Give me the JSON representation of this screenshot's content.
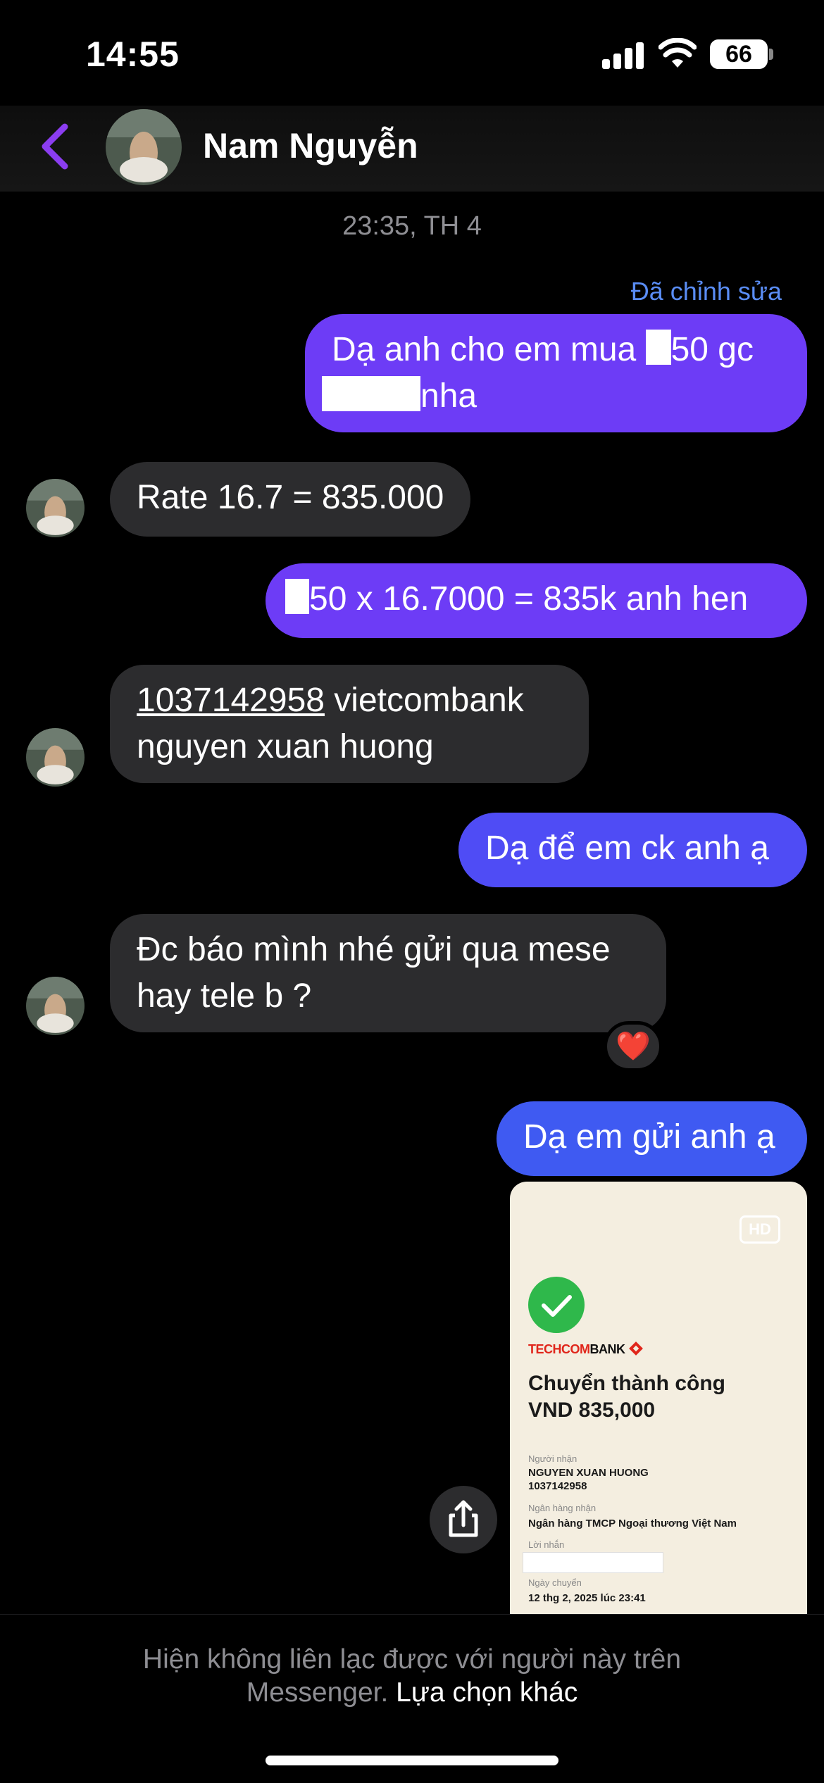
{
  "status_bar": {
    "time": "14:55",
    "battery": "66"
  },
  "header": {
    "contact_name": "Nam Nguyễn",
    "back_icon": "chevron-left-icon"
  },
  "thread": {
    "timestamp": "23:35, TH 4",
    "edited_label": "Đã chỉnh sửa",
    "messages": [
      {
        "from": "me",
        "line1_a": "Dạ anh cho em mua ",
        "line1_b": "50 gc",
        "line2": "nha"
      },
      {
        "from": "them",
        "text": "Rate 16.7 = 835.000"
      },
      {
        "from": "me",
        "text": "50 x 16.7000 = 835k anh hen"
      },
      {
        "from": "them",
        "account": "1037142958",
        "line1_rest": " vietcombank",
        "line2": "nguyen xuan huong"
      },
      {
        "from": "me",
        "text": "Dạ để em ck anh ạ"
      },
      {
        "from": "them",
        "line1": "Đc báo mình nhé gửi qua mese",
        "line2": "hay tele b ?",
        "reaction": "❤️"
      },
      {
        "from": "me",
        "text": "Dạ em gửi anh ạ"
      }
    ]
  },
  "receipt": {
    "hd_badge": "HD",
    "bank_a": "TECHCOM",
    "bank_b": "BANK",
    "title_line1": "Chuyển thành công",
    "title_line2": "VND 835,000",
    "recipient_label": "Người nhận",
    "recipient_name": "NGUYEN XUAN HUONG",
    "recipient_account": "1037142958",
    "bank_label": "Ngân hàng nhận",
    "bank_name": "Ngân hàng TMCP Ngoại thương Việt Nam",
    "message_label": "Lời nhắn",
    "date_label": "Ngày chuyển",
    "date_value": "12 thg 2, 2025 lúc 23:41"
  },
  "footer": {
    "notice_line1": "Hiện không liên lạc được với người này trên",
    "notice_line2": "Messenger.",
    "link": "Lựa chọn khác"
  }
}
